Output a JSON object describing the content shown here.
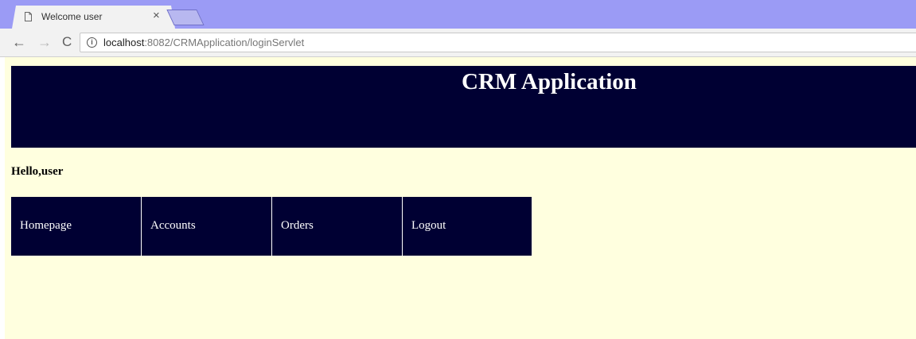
{
  "browser": {
    "tab_title": "Welcome user",
    "tab_close": "×",
    "url_host": "localhost",
    "url_rest": ":8082/CRMApplication/loginServlet",
    "back_icon": "←",
    "forward_icon": "→",
    "reload_icon": "C"
  },
  "page": {
    "header_title": "CRM Application",
    "greeting": "Hello,user",
    "menu": [
      {
        "label": "Homepage"
      },
      {
        "label": "Accounts"
      },
      {
        "label": "Orders"
      },
      {
        "label": "Logout"
      }
    ]
  },
  "colors": {
    "header_bg": "#000033",
    "page_bg": "#ffffdf",
    "tabstrip_bg": "#9b9bf5"
  }
}
